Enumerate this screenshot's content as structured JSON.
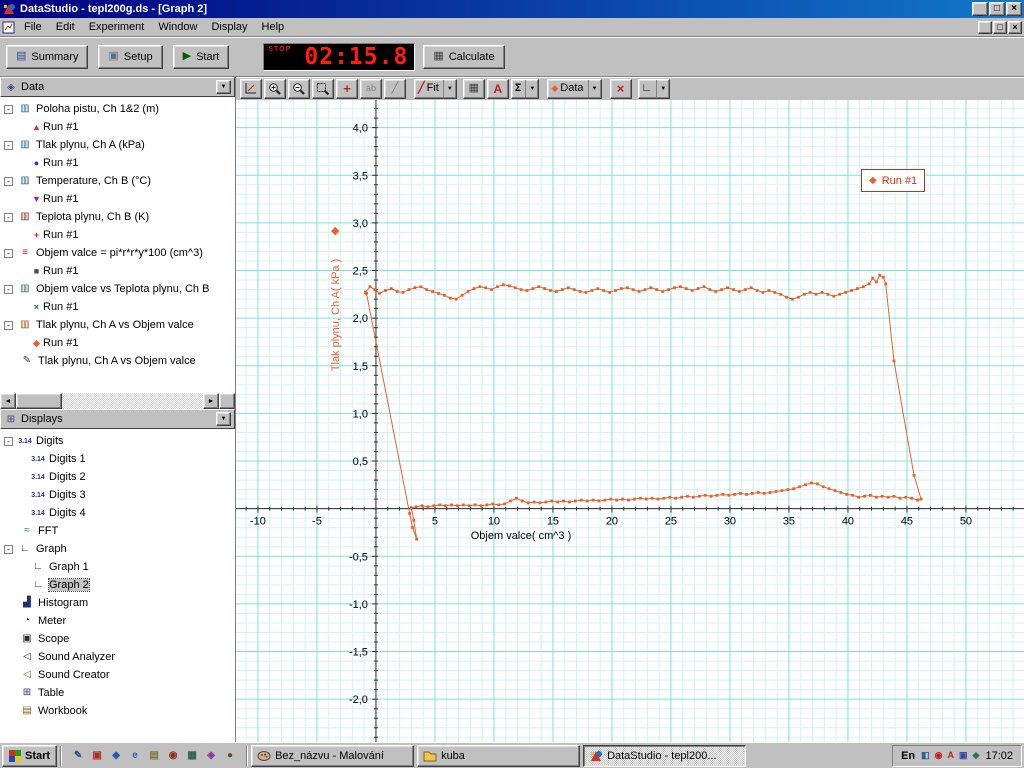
{
  "window": {
    "title": "DataStudio - tepl200g.ds - [Graph 2]"
  },
  "menu": {
    "items": [
      "File",
      "Edit",
      "Experiment",
      "Window",
      "Display",
      "Help"
    ]
  },
  "toolbar": {
    "summary_label": "Summary",
    "setup_label": "Setup",
    "start_label": "Start",
    "calculate_label": "Calculate",
    "timer": {
      "stop_label": "STOP",
      "value": "02:15.8"
    }
  },
  "graph_toolbar": {
    "fit_label": "Fit",
    "data_label": "Data"
  },
  "icons": {
    "dropdown": "▼",
    "collapse": "-",
    "sigma": "Σ",
    "text_tool": "A",
    "delete_x": "×",
    "diamond": "◆",
    "start_play": "▶",
    "summary_icon": "▤",
    "setup_icon": "▣",
    "calculate_icon": "▦",
    "smart_tool": "+",
    "note_tool": "ab",
    "slope_tool": "╱",
    "fit_icon": "╱",
    "graph_settings": "∟",
    "minimize": "_",
    "restore": "□",
    "close": "×",
    "scroll_left": "◄",
    "scroll_right": "►",
    "data_header_icon": "◈",
    "displays_header_icon": "⊞"
  },
  "sidebar": {
    "data_panel": {
      "title": "Data",
      "items": [
        {
          "label": "Poloha pistu, Ch 1&2 (m)",
          "expandable": true,
          "icon": {
            "name": "position-sensor-icon",
            "glyph": "▥",
            "color": "#286090"
          },
          "runs": [
            {
              "label": "Run #1",
              "marker": {
                "name": "run-marker-red-triangle",
                "glyph": "▲",
                "color": "#d83028"
              }
            }
          ]
        },
        {
          "label": "Tlak plynu, Ch A (kPa)",
          "expandable": true,
          "icon": {
            "name": "pressure-sensor-icon",
            "glyph": "▥",
            "color": "#286090"
          },
          "runs": [
            {
              "label": "Run #1",
              "marker": {
                "name": "run-marker-blue-circle",
                "glyph": "●",
                "color": "#2838c8"
              }
            }
          ]
        },
        {
          "label": "Temperature, Ch B (°C)",
          "expandable": true,
          "icon": {
            "name": "temperature-sensor-icon",
            "glyph": "▥",
            "color": "#286090"
          },
          "runs": [
            {
              "label": "Run #1",
              "marker": {
                "name": "run-marker-violet-triangle",
                "glyph": "▼",
                "color": "#8830a8"
              }
            }
          ]
        },
        {
          "label": "Teplota plynu, Ch B (K)",
          "expandable": true,
          "icon": {
            "name": "calculated-temperature-icon",
            "glyph": "▥",
            "color": "#902818"
          },
          "runs": [
            {
              "label": "Run #1",
              "marker": {
                "name": "run-marker-red-cross",
                "glyph": "+",
                "color": "#d02020"
              }
            }
          ]
        },
        {
          "label": "Objem valce = pi*r*r*y*100 (cm^3)",
          "expandable": true,
          "icon": {
            "name": "calculator-icon",
            "glyph": "≡",
            "color": "#c02020"
          },
          "runs": [
            {
              "label": "Run #1",
              "marker": {
                "name": "run-marker-dark-square",
                "glyph": "■",
                "color": "#385838"
              }
            }
          ]
        },
        {
          "label": "Objem valce vs Teplota plynu, Ch B",
          "expandable": true,
          "icon": {
            "name": "xy-data-icon",
            "glyph": "▥",
            "color": "#287040"
          },
          "runs": [
            {
              "label": "Run #1",
              "marker": {
                "name": "run-marker-green-x",
                "glyph": "×",
                "color": "#188030"
              }
            }
          ]
        },
        {
          "label": "Tlak plynu, Ch A vs Objem valce",
          "expandable": true,
          "icon": {
            "name": "xy-data-icon",
            "glyph": "▥",
            "color": "#a05020"
          },
          "runs": [
            {
              "label": "Run #1",
              "marker": {
                "name": "run-marker-orange-diamond",
                "glyph": "◆",
                "color": "#e8622d"
              }
            }
          ]
        },
        {
          "label": "Tlak plynu, Ch A vs Objem valce",
          "expandable": false,
          "icon": {
            "name": "pencil-data-icon",
            "glyph": "✎",
            "color": "#303030"
          },
          "runs": []
        }
      ]
    },
    "displays_panel": {
      "title": "Displays",
      "items": [
        {
          "label": "Digits",
          "expandable": true,
          "icon": {
            "name": "digits-icon",
            "glyph": "3.14",
            "color": "#203080"
          },
          "children": [
            {
              "label": "Digits 1",
              "icon": {
                "name": "digits-icon",
                "glyph": "3.14",
                "color": "#203080"
              }
            },
            {
              "label": "Digits 2",
              "icon": {
                "name": "digits-icon",
                "glyph": "3.14",
                "color": "#203080"
              }
            },
            {
              "label": "Digits 3",
              "icon": {
                "name": "digits-icon",
                "glyph": "3.14",
                "color": "#203080"
              }
            },
            {
              "label": "Digits 4",
              "icon": {
                "name": "digits-icon",
                "glyph": "3.14",
                "color": "#203080"
              }
            }
          ]
        },
        {
          "label": "FFT",
          "icon": {
            "name": "fft-icon",
            "glyph": "≈",
            "color": "#108030"
          }
        },
        {
          "label": "Graph",
          "expandable": true,
          "icon": {
            "name": "graph-icon",
            "glyph": "∟",
            "color": "#303030"
          },
          "children": [
            {
              "label": "Graph 1",
              "icon": {
                "name": "graph-icon",
                "glyph": "∟",
                "color": "#303030"
              }
            },
            {
              "label": "Graph 2",
              "selected": true,
              "icon": {
                "name": "graph-icon",
                "glyph": "∟",
                "color": "#303030"
              }
            }
          ]
        },
        {
          "label": "Histogram",
          "icon": {
            "name": "histogram-icon",
            "glyph": "▟",
            "color": "#203080"
          }
        },
        {
          "label": "Meter",
          "icon": {
            "name": "meter-icon",
            "glyph": "◔",
            "color": "#303030"
          }
        },
        {
          "label": "Scope",
          "icon": {
            "name": "scope-icon",
            "glyph": "▣",
            "color": "#203030"
          }
        },
        {
          "label": "Sound Analyzer",
          "icon": {
            "name": "sound-analyzer-icon",
            "glyph": "◁",
            "color": "#303030"
          }
        },
        {
          "label": "Sound Creator",
          "icon": {
            "name": "sound-creator-icon",
            "glyph": "◁",
            "color": "#806020"
          }
        },
        {
          "label": "Table",
          "icon": {
            "name": "table-icon",
            "glyph": "⊞",
            "color": "#203080"
          }
        },
        {
          "label": "Workbook",
          "icon": {
            "name": "workbook-icon",
            "glyph": "▤",
            "color": "#806020"
          }
        }
      ]
    }
  },
  "chart_data": {
    "type": "scatter",
    "title": "",
    "xlabel": "Objem valce( cm^3 )",
    "ylabel": "Tlak plynu, Ch A( kPa )",
    "legend": {
      "label": "Run #1",
      "position": "top-right"
    },
    "series_color": "#e8622d",
    "grid": {
      "minor_color": "#d2f3f3",
      "major_color": "#80e0e0",
      "axis_color": "#303030"
    },
    "x_axis": {
      "min": -11.86,
      "max": 54.92,
      "major_step": 5,
      "minor_step": 1,
      "major_ticks": [
        -10,
        -5,
        5,
        10,
        15,
        20,
        25,
        30,
        35,
        40,
        45,
        50
      ],
      "tick_labels": [
        "-10",
        "-5",
        "5",
        "10",
        "15",
        "20",
        "25",
        "30",
        "35",
        "40",
        "45",
        "50"
      ]
    },
    "y_axis": {
      "min": -2.46,
      "max": 4.29,
      "major_step": 0.5,
      "minor_step": 0.1,
      "major_ticks": [
        4.0,
        3.5,
        3.0,
        2.5,
        2.0,
        1.5,
        1.0,
        0.5,
        -0.5,
        -1.0,
        -1.5,
        -2.0
      ],
      "tick_labels": [
        "4,0",
        "3,5",
        "3,0",
        "2,5",
        "2,0",
        "1,5",
        "1,0",
        "0,5",
        "-0,5",
        "-1,0",
        "-1,5",
        "-2,0"
      ]
    },
    "points": [
      [
        -0.9,
        2.27
      ],
      [
        -0.5,
        2.33
      ],
      [
        -0.1,
        2.3
      ],
      [
        0.3,
        2.26
      ],
      [
        0.8,
        2.29
      ],
      [
        1.3,
        2.31
      ],
      [
        1.8,
        2.28
      ],
      [
        2.3,
        2.27
      ],
      [
        2.8,
        2.3
      ],
      [
        3.3,
        2.32
      ],
      [
        3.8,
        2.33
      ],
      [
        4.3,
        2.3
      ],
      [
        4.8,
        2.28
      ],
      [
        5.3,
        2.26
      ],
      [
        5.8,
        2.24
      ],
      [
        6.3,
        2.21
      ],
      [
        6.8,
        2.2
      ],
      [
        7.3,
        2.24
      ],
      [
        7.8,
        2.28
      ],
      [
        8.3,
        2.31
      ],
      [
        8.8,
        2.33
      ],
      [
        9.3,
        2.32
      ],
      [
        9.8,
        2.3
      ],
      [
        10.3,
        2.33
      ],
      [
        10.8,
        2.35
      ],
      [
        11.3,
        2.34
      ],
      [
        11.8,
        2.32
      ],
      [
        12.3,
        2.3
      ],
      [
        12.8,
        2.29
      ],
      [
        13.3,
        2.31
      ],
      [
        13.8,
        2.33
      ],
      [
        14.3,
        2.31
      ],
      [
        14.8,
        2.29
      ],
      [
        15.3,
        2.28
      ],
      [
        15.8,
        2.3
      ],
      [
        16.3,
        2.32
      ],
      [
        16.8,
        2.3
      ],
      [
        17.3,
        2.28
      ],
      [
        17.8,
        2.27
      ],
      [
        18.3,
        2.29
      ],
      [
        18.8,
        2.31
      ],
      [
        19.3,
        2.29
      ],
      [
        19.8,
        2.27
      ],
      [
        20.3,
        2.29
      ],
      [
        20.8,
        2.31
      ],
      [
        21.3,
        2.32
      ],
      [
        21.8,
        2.3
      ],
      [
        22.3,
        2.28
      ],
      [
        22.8,
        2.3
      ],
      [
        23.3,
        2.32
      ],
      [
        23.8,
        2.3
      ],
      [
        24.3,
        2.28
      ],
      [
        24.8,
        2.3
      ],
      [
        25.3,
        2.32
      ],
      [
        25.8,
        2.33
      ],
      [
        26.3,
        2.31
      ],
      [
        26.8,
        2.29
      ],
      [
        27.3,
        2.31
      ],
      [
        27.8,
        2.33
      ],
      [
        28.3,
        2.3
      ],
      [
        28.8,
        2.28
      ],
      [
        29.3,
        2.3
      ],
      [
        29.8,
        2.32
      ],
      [
        30.3,
        2.3
      ],
      [
        30.8,
        2.28
      ],
      [
        31.3,
        2.3
      ],
      [
        31.8,
        2.32
      ],
      [
        32.3,
        2.29
      ],
      [
        32.8,
        2.27
      ],
      [
        33.3,
        2.29
      ],
      [
        33.8,
        2.27
      ],
      [
        34.3,
        2.25
      ],
      [
        34.8,
        2.22
      ],
      [
        35.3,
        2.2
      ],
      [
        35.8,
        2.22
      ],
      [
        36.3,
        2.25
      ],
      [
        36.8,
        2.27
      ],
      [
        37.3,
        2.25
      ],
      [
        37.8,
        2.27
      ],
      [
        38.3,
        2.25
      ],
      [
        38.8,
        2.23
      ],
      [
        39.3,
        2.25
      ],
      [
        39.8,
        2.27
      ],
      [
        40.3,
        2.29
      ],
      [
        40.8,
        2.31
      ],
      [
        41.3,
        2.33
      ],
      [
        41.8,
        2.36
      ],
      [
        42.1,
        2.42
      ],
      [
        42.4,
        2.38
      ],
      [
        42.7,
        2.45
      ],
      [
        43.0,
        2.43
      ],
      [
        43.2,
        2.36
      ],
      [
        43.9,
        1.55
      ],
      [
        45.6,
        0.35
      ],
      [
        46.2,
        0.1
      ],
      [
        45.9,
        0.09
      ],
      [
        45.4,
        0.11
      ],
      [
        44.9,
        0.12
      ],
      [
        44.4,
        0.11
      ],
      [
        43.9,
        0.13
      ],
      [
        43.4,
        0.12
      ],
      [
        42.9,
        0.13
      ],
      [
        42.4,
        0.12
      ],
      [
        41.9,
        0.14
      ],
      [
        41.4,
        0.13
      ],
      [
        40.9,
        0.12
      ],
      [
        40.4,
        0.14
      ],
      [
        39.9,
        0.15
      ],
      [
        39.4,
        0.17
      ],
      [
        38.9,
        0.19
      ],
      [
        38.4,
        0.21
      ],
      [
        37.9,
        0.23
      ],
      [
        37.4,
        0.26
      ],
      [
        36.9,
        0.27
      ],
      [
        36.4,
        0.25
      ],
      [
        35.9,
        0.23
      ],
      [
        35.4,
        0.21
      ],
      [
        34.9,
        0.2
      ],
      [
        34.4,
        0.19
      ],
      [
        33.9,
        0.18
      ],
      [
        33.4,
        0.17
      ],
      [
        32.9,
        0.16
      ],
      [
        32.4,
        0.17
      ],
      [
        31.9,
        0.16
      ],
      [
        31.4,
        0.15
      ],
      [
        30.9,
        0.16
      ],
      [
        30.4,
        0.15
      ],
      [
        29.9,
        0.14
      ],
      [
        29.4,
        0.15
      ],
      [
        28.9,
        0.14
      ],
      [
        28.4,
        0.13
      ],
      [
        27.9,
        0.14
      ],
      [
        27.4,
        0.13
      ],
      [
        26.9,
        0.12
      ],
      [
        26.4,
        0.13
      ],
      [
        25.9,
        0.12
      ],
      [
        25.4,
        0.11
      ],
      [
        24.9,
        0.12
      ],
      [
        24.4,
        0.11
      ],
      [
        23.9,
        0.1
      ],
      [
        23.4,
        0.11
      ],
      [
        22.9,
        0.1
      ],
      [
        22.4,
        0.11
      ],
      [
        21.9,
        0.1
      ],
      [
        21.4,
        0.09
      ],
      [
        20.9,
        0.1
      ],
      [
        20.4,
        0.09
      ],
      [
        19.9,
        0.1
      ],
      [
        19.4,
        0.09
      ],
      [
        18.9,
        0.08
      ],
      [
        18.4,
        0.09
      ],
      [
        17.9,
        0.08
      ],
      [
        17.4,
        0.09
      ],
      [
        16.9,
        0.08
      ],
      [
        16.4,
        0.07
      ],
      [
        15.9,
        0.08
      ],
      [
        15.4,
        0.07
      ],
      [
        14.9,
        0.08
      ],
      [
        14.4,
        0.07
      ],
      [
        13.9,
        0.06
      ],
      [
        13.4,
        0.07
      ],
      [
        12.9,
        0.06
      ],
      [
        12.4,
        0.08
      ],
      [
        11.9,
        0.11
      ],
      [
        11.4,
        0.08
      ],
      [
        10.9,
        0.05
      ],
      [
        10.4,
        0.04
      ],
      [
        9.9,
        0.05
      ],
      [
        9.4,
        0.04
      ],
      [
        8.9,
        0.03
      ],
      [
        8.4,
        0.04
      ],
      [
        7.9,
        0.03
      ],
      [
        7.4,
        0.04
      ],
      [
        6.9,
        0.03
      ],
      [
        6.4,
        0.04
      ],
      [
        5.9,
        0.03
      ],
      [
        5.4,
        0.04
      ],
      [
        4.9,
        0.03
      ],
      [
        4.4,
        0.02
      ],
      [
        3.9,
        0.03
      ],
      [
        3.4,
        0.02
      ],
      [
        3.0,
        0.01
      ],
      [
        3.2,
        -0.12
      ],
      [
        3.45,
        -0.32
      ],
      [
        3.1,
        -0.2
      ],
      [
        2.85,
        -0.05
      ],
      [
        -0.8,
        2.26
      ]
    ]
  },
  "taskbar": {
    "start_label": "Start",
    "quick_launch": [
      {
        "name": "shortcut-icon-1",
        "glyph": "✎",
        "color": "#305080"
      },
      {
        "name": "shortcut-icon-2",
        "glyph": "▣",
        "color": "#b03020"
      },
      {
        "name": "shortcut-icon-3",
        "glyph": "◆",
        "color": "#2858b0"
      },
      {
        "name": "internet-explorer-icon",
        "glyph": "e",
        "color": "#2868c8"
      },
      {
        "name": "shortcut-icon-5",
        "glyph": "▤",
        "color": "#787838"
      },
      {
        "name": "shortcut-icon-6",
        "glyph": "◉",
        "color": "#903018"
      },
      {
        "name": "shortcut-icon-7",
        "glyph": "▦",
        "color": "#286048"
      },
      {
        "name": "shortcut-icon-8",
        "glyph": "◈",
        "color": "#8838a0"
      },
      {
        "name": "shortcut-icon-9",
        "glyph": "●",
        "color": "#704818"
      }
    ],
    "tasks": [
      {
        "label": "Bez_názvu - Malování",
        "active": false,
        "app": "paint"
      },
      {
        "label": "kuba",
        "active": false,
        "app": "folder"
      },
      {
        "label": "DataStudio - tepl200...",
        "active": true,
        "app": "datastudio"
      }
    ],
    "tray": {
      "lang": "En",
      "time": "17:02",
      "icons": [
        {
          "name": "tray-icon-1",
          "glyph": "◧",
          "color": "#3060a0"
        },
        {
          "name": "tray-icon-2",
          "glyph": "◉",
          "color": "#c02020"
        },
        {
          "name": "antivirus-icon",
          "glyph": "A",
          "color": "#c02020"
        },
        {
          "name": "tray-icon-4",
          "glyph": "▣",
          "color": "#3048a0"
        },
        {
          "name": "tray-icon-5",
          "glyph": "◆",
          "color": "#287858"
        }
      ]
    }
  }
}
